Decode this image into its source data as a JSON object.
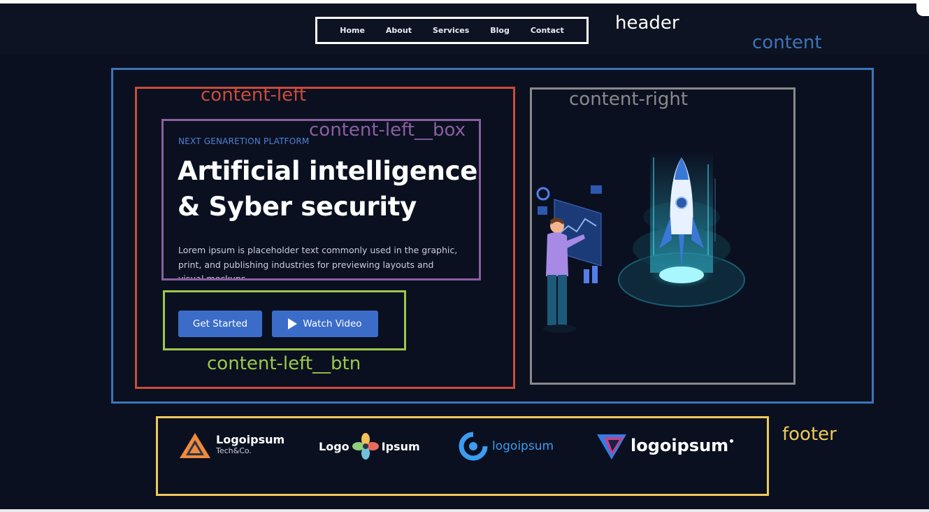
{
  "nav": {
    "items": [
      "Home",
      "About",
      "Services",
      "Blog",
      "Contact"
    ]
  },
  "annotations": {
    "header": "header",
    "content": "content",
    "content_left": "content-left",
    "content_right": "content-right",
    "content_left_box": "content-left__box",
    "content_left_btn": "content-left__btn",
    "footer": "footer"
  },
  "hero": {
    "tagline": "NEXT GENARETION PLATFORM",
    "headline_line1": "Artificial intelligence",
    "headline_line2": "& Syber security",
    "description": "Lorem ipsum is placeholder text commonly used in the graphic, print, and publishing industries for previewing layouts and visual mockups.",
    "btn_primary": "Get Started",
    "btn_secondary": "Watch Video"
  },
  "footer": {
    "logos": [
      {
        "name": "Logoipsum",
        "sub": "Tech&Co."
      },
      {
        "name_left": "Logo",
        "name_right": "Ipsum"
      },
      {
        "name_a": "logo",
        "name_b": "ipsum"
      },
      {
        "name": "logoipsum"
      }
    ]
  },
  "colors": {
    "background": "#0a1020",
    "header_box": "#ffffff",
    "content_box": "#3d74b8",
    "content_left_box": "#cc4b3c",
    "content_right_box": "#8a8a8a",
    "left_inner_box": "#8a5fa0",
    "btn_box": "#9cc84a",
    "footer_box": "#efc95a",
    "accent": "#3b6cc8"
  }
}
